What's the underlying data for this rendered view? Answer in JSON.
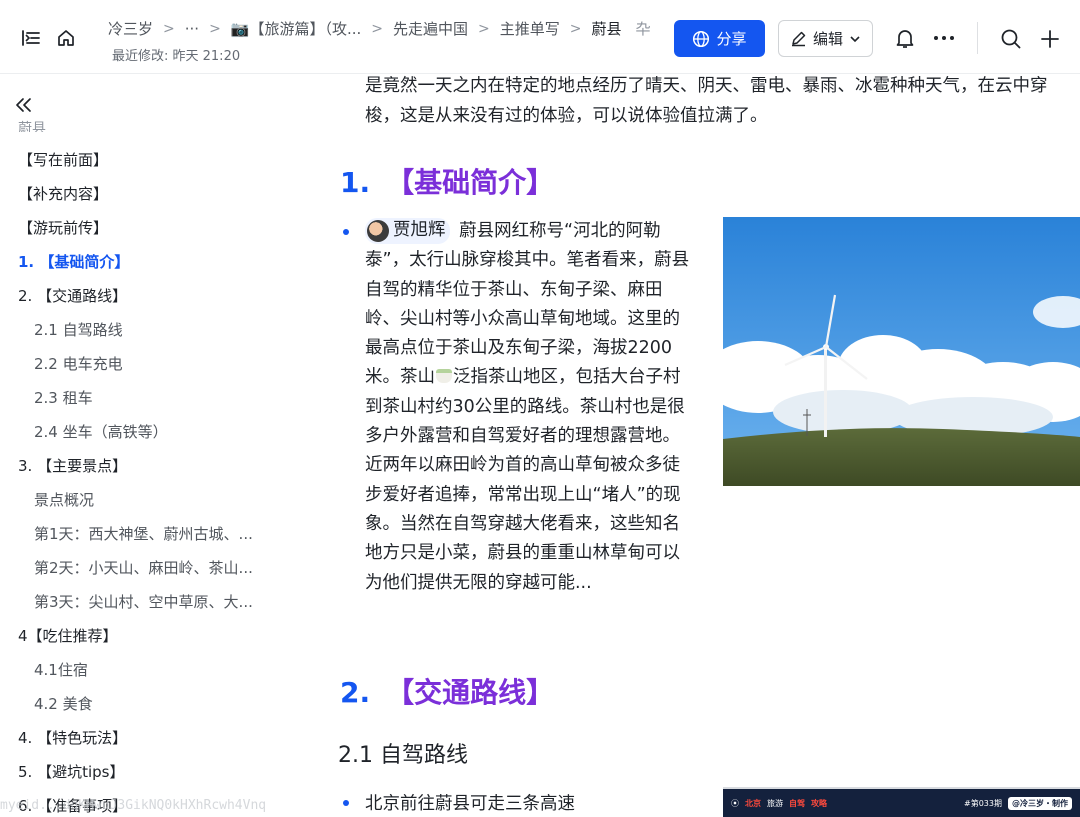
{
  "header": {
    "breadcrumb": {
      "root": "冷三岁",
      "ellipsis": "···",
      "item_travel": "📷【旅游篇】（攻...",
      "item_china": "先走遍中国",
      "item_main": "主推单写",
      "current": "蔚县",
      "cut": "卆"
    },
    "last_modified": "最近修改: 昨天 21:20",
    "share_label": "分享",
    "edit_label": "编辑",
    "accent_color": "#1456f0"
  },
  "sidebar": {
    "ghost_text": "蔚县",
    "items": [
      {
        "label": "【写在前面】"
      },
      {
        "label": "【补充内容】"
      },
      {
        "label": "【游玩前传】"
      },
      {
        "label": "1. 【基础简介】"
      },
      {
        "label": "2. 【交通路线】"
      },
      {
        "label": "2.1 自驾路线"
      },
      {
        "label": "2.2 电车充电"
      },
      {
        "label": "2.3 租车"
      },
      {
        "label": "2.4 坐车（高铁等）"
      },
      {
        "label": "3. 【主要景点】"
      },
      {
        "label": "景点概况"
      },
      {
        "label": "第1天：西大神堡、蔚州古城、..."
      },
      {
        "label": "第2天：小天山、麻田岭、茶山..."
      },
      {
        "label": "第3天：尖山村、空中草原、大..."
      },
      {
        "label": "4【吃住推荐】"
      },
      {
        "label": "4.1住宿"
      },
      {
        "label": "4.2 美食"
      },
      {
        "label": "4. 【特色玩法】"
      },
      {
        "label": "5. 【避坑tips】"
      },
      {
        "label": "6. 【准备事项】"
      }
    ]
  },
  "content": {
    "intro": "是竟然一天之内在特定的地点经历了晴天、阴天、雷电、暴雨、冰雹种种天气，在云中穿梭，这是从来没有过的体验，可以说体验值拉满了。",
    "section1": {
      "num": "1.",
      "title": "【基础简介】"
    },
    "mention_name": "贾旭辉",
    "para_a": " 蔚县网红称号“河北的阿勒泰”，太行山脉穿梭其中。笔者看来，蔚县自驾的精华位于茶山、东甸子梁、麻田岭、尖山村等小众高山草甸地域。这里的最高点位于茶山及东甸子梁，海拔2200米。茶山",
    "para_b": "泛指茶山地区，包括大台子村到茶山村约30公里的路线。茶山村也是很多户外露营和自驾爱好者的理想露营地。近两年以麻田岭为首的高山草甸被众多徒步爱好者追捧，常常出现上山“堵人”的现象。当然在自驾穿越大佬看来，这些知名地方只是小菜，蔚县的重重山林草甸可以为他们提供无限的穿越可能...",
    "section2": {
      "num": "2.",
      "title": "【交通路线】"
    },
    "subsection": "2.1 自驾路线",
    "list_item": "北京前往蔚县可走三条高速",
    "banner": {
      "a": "北京",
      "b": "旅游",
      "c": "自驾",
      "d": "攻略",
      "issue": "#第033期",
      "credit": "@冷三岁・制作"
    }
  },
  "watermark": "myeid...dqKMwuJ3GikNQ0kHXhRcwh4Vnq"
}
